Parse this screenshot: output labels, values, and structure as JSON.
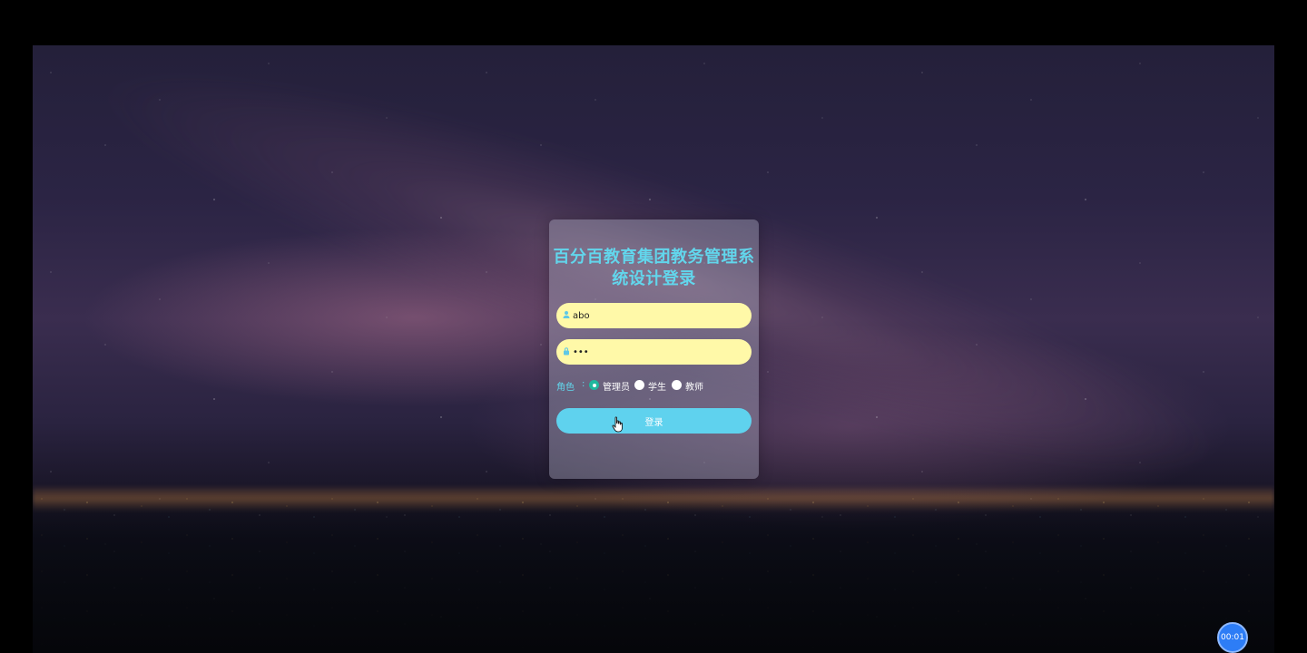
{
  "login": {
    "title": "百分百教育集团教务管理系统设计登录",
    "username_value": "abo",
    "password_value": "•••",
    "role_label": "角色",
    "roles": [
      "管理员",
      "学生",
      "教师"
    ],
    "selected_role": "管理员",
    "login_button_label": "登录"
  },
  "overlay": {
    "timer_text": "00:01"
  },
  "colors": {
    "accent": "#62d6ec",
    "input_bg": "#fff9a8",
    "button_bg": "#5fd2ee",
    "radio_checked": "#1fb79e",
    "timer_bg": "#2d7df6"
  },
  "icons": {
    "username": "user-icon",
    "password": "lock-icon",
    "cursor": "hand-pointer-icon"
  }
}
